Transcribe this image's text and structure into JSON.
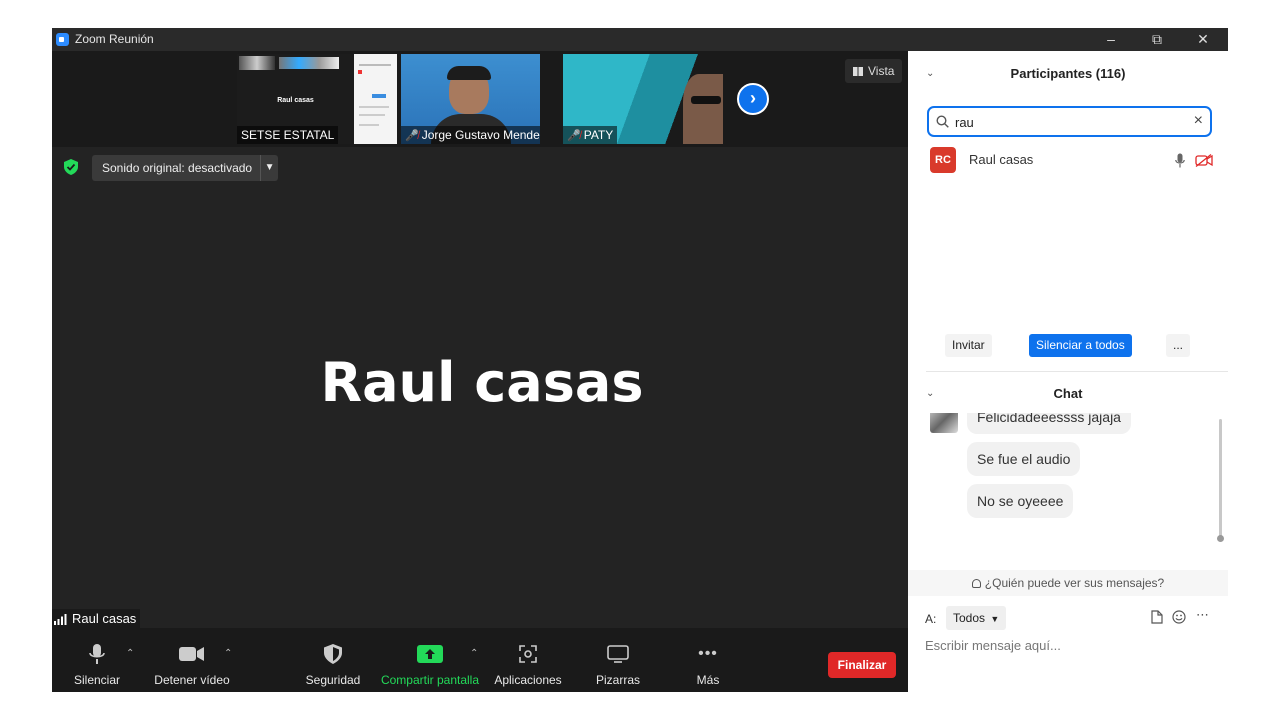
{
  "window": {
    "title": "Zoom Reunión"
  },
  "strip": {
    "thumbs": [
      {
        "label": "SETSE ESTATAL",
        "inner_text": "Raul casas",
        "muted": false
      },
      {
        "label": "Jorge Gustavo Mendez",
        "muted": true
      },
      {
        "label": "PATY",
        "muted": true
      }
    ],
    "view_label": "Vista"
  },
  "sound_original": "Sonido original: desactivado",
  "active_speaker": {
    "big_name": "Raul casas",
    "name_tag": "Raul casas"
  },
  "toolbar": {
    "mute": "Silenciar",
    "stop_video": "Detener vídeo",
    "security": "Seguridad",
    "share": "Compartir pantalla",
    "apps": "Aplicaciones",
    "whiteboards": "Pizarras",
    "more": "Más",
    "end": "Finalizar"
  },
  "participants": {
    "header": "Participantes (116)",
    "search_value": "rau",
    "list": [
      {
        "initials": "RC",
        "name": "Raul casas"
      }
    ],
    "invite": "Invitar",
    "mute_all": "Silenciar a todos",
    "more": "..."
  },
  "chat": {
    "header": "Chat",
    "messages": [
      "Felicidadeeessss jajaja",
      "Se fue el audio",
      "No se oyeeee"
    ],
    "who_can_see": "¿Quién puede ver sus mensajes?",
    "to_label": "A:",
    "to_value": "Todos",
    "input_placeholder": "Escribir mensaje aquí..."
  },
  "colors": {
    "accent": "#0e72ed",
    "end": "#e02828",
    "share": "#23d959",
    "avatar": "#d93a2b"
  }
}
